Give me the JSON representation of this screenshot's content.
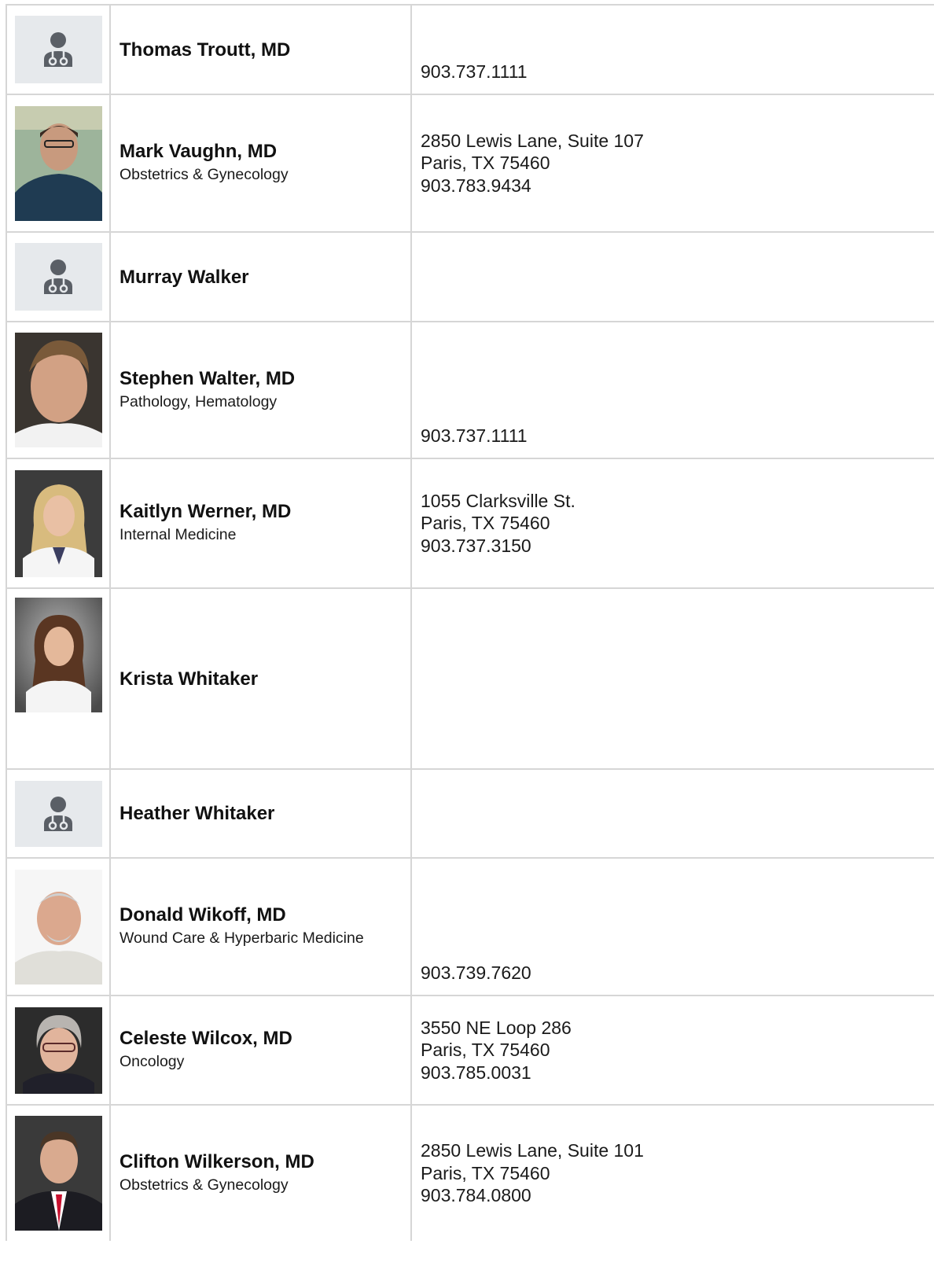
{
  "colors": {
    "border": "#d6d6d6",
    "placeholder_bg": "#e6e9ec",
    "placeholder_icon": "#5a5f66",
    "text": "#111111"
  },
  "providers": [
    {
      "name": "Thomas Troutt, MD",
      "specialty": "",
      "address1": "",
      "address2": "",
      "phone": "903.737.1111",
      "photo_icon": "doctor-placeholder-icon"
    },
    {
      "name": "Mark Vaughn, MD",
      "specialty": "Obstetrics & Gynecology",
      "address1": "2850 Lewis Lane, Suite 107",
      "address2": "Paris, TX 75460",
      "phone": "903.783.9434",
      "photo_icon": "doctor-photo"
    },
    {
      "name": "Murray Walker",
      "specialty": "",
      "address1": "",
      "address2": "",
      "phone": "",
      "photo_icon": "doctor-placeholder-icon"
    },
    {
      "name": "Stephen Walter, MD",
      "specialty": "Pathology, Hematology",
      "address1": "",
      "address2": "",
      "phone": "903.737.1111",
      "photo_icon": "doctor-photo"
    },
    {
      "name": "Kaitlyn Werner, MD",
      "specialty": "Internal Medicine",
      "address1": "1055 Clarksville St.",
      "address2": "Paris, TX 75460",
      "phone": "903.737.3150",
      "photo_icon": "doctor-photo"
    },
    {
      "name": "Krista Whitaker",
      "specialty": "",
      "address1": "",
      "address2": "",
      "phone": "",
      "photo_icon": "doctor-photo"
    },
    {
      "name": "Heather Whitaker",
      "specialty": "",
      "address1": "",
      "address2": "",
      "phone": "",
      "photo_icon": "doctor-placeholder-icon"
    },
    {
      "name": "Donald Wikoff, MD",
      "specialty": "Wound Care & Hyperbaric Medicine",
      "address1": "",
      "address2": "",
      "phone": "903.739.7620",
      "photo_icon": "doctor-photo"
    },
    {
      "name": "Celeste Wilcox, MD",
      "specialty": "Oncology",
      "address1": "3550 NE Loop 286",
      "address2": "Paris, TX 75460",
      "phone": "903.785.0031",
      "photo_icon": "doctor-photo"
    },
    {
      "name": "Clifton Wilkerson, MD",
      "specialty": "Obstetrics & Gynecology",
      "address1": "2850 Lewis Lane, Suite 101",
      "address2": "Paris, TX 75460",
      "phone": "903.784.0800",
      "photo_icon": "doctor-photo"
    }
  ]
}
